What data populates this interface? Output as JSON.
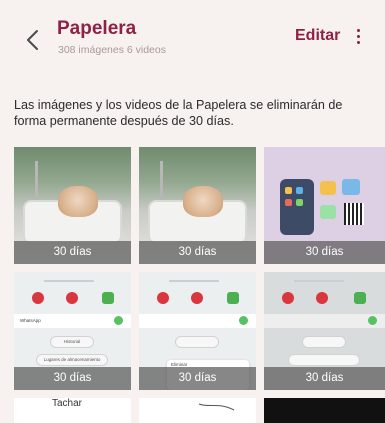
{
  "header": {
    "title": "Papelera",
    "subtitle": "308 imágenes 6 videos",
    "edit_label": "Editar"
  },
  "notice": "Las imágenes y los videos de la Papelera se eliminarán de forma permanente después de 30 días.",
  "items": [
    {
      "days_label": "30 días"
    },
    {
      "days_label": "30 días"
    },
    {
      "days_label": "30 días"
    },
    {
      "days_label": "30 días"
    },
    {
      "days_label": "30 días"
    },
    {
      "days_label": "30 días"
    }
  ],
  "tile_texts": {
    "whatsapp": "WhatsApp",
    "historial": "Historial",
    "lugares": "Lugares de almacenamiento",
    "eliminar": "Eliminar",
    "tachar": "Tachar"
  },
  "colors": {
    "accent": "#8e2246",
    "background": "#f7f1ef"
  },
  "icons": [
    "back-icon",
    "more-icon"
  ]
}
